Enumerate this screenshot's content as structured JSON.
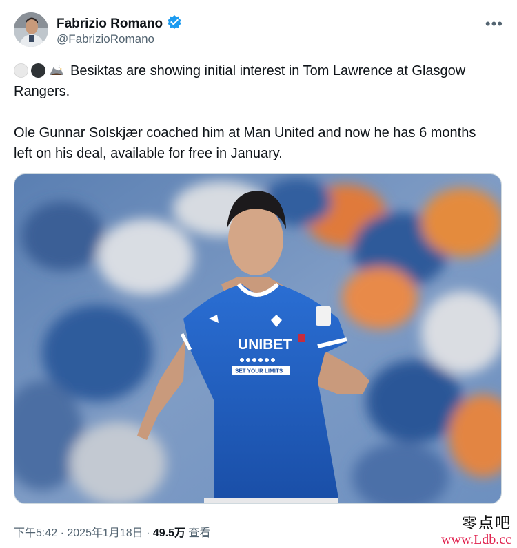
{
  "author": {
    "display_name": "Fabrizio Romano",
    "handle": "@FabrizioRomano"
  },
  "icons": [
    "verified-badge-icon",
    "more-options-icon",
    "white-circle-emoji",
    "black-circle-emoji",
    "eagle-emoji"
  ],
  "tweet": {
    "line1": "Besiktas are showing initial interest in Tom Lawrence at Glasgow Rangers.",
    "line2": "Ole Gunnar Solskjær coached him at Man United and now he has 6 months left on his deal, available for free in January."
  },
  "media": {
    "sponsor": "UNIBET",
    "tagline": "SET YOUR LIMITS"
  },
  "meta": {
    "time": "下午5:42",
    "sep1": " · ",
    "date": "2025年1月18日",
    "sep2": " · ",
    "views": "49.5万",
    "views_label": "查看"
  },
  "watermark": {
    "cn": "零点吧",
    "url": "www.Ldb.cc"
  },
  "colors": {
    "verified": "#1d9bf0",
    "text": "#0f1419",
    "muted": "#536471",
    "shirt": "#1f5fbf",
    "watermark_url": "#e0224e"
  }
}
